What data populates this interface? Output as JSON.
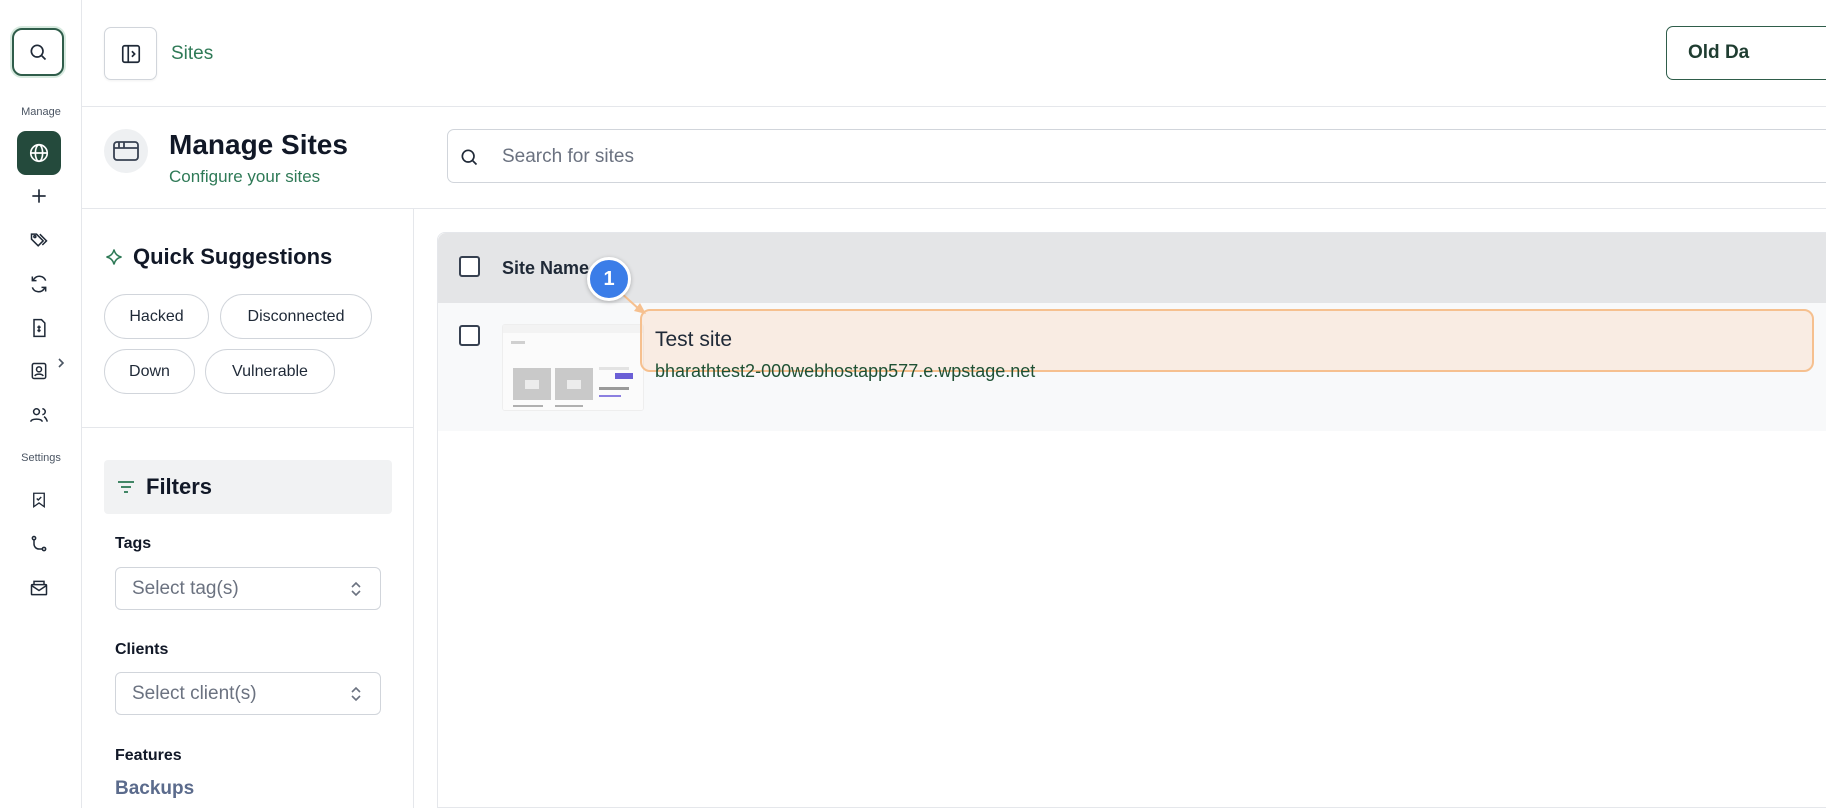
{
  "rail": {
    "manage_label": "Manage",
    "settings_label": "Settings",
    "icons": [
      "search-icon",
      "globe-icon",
      "plus-icon",
      "tags-icon",
      "sync-icon",
      "report-icon",
      "contact-badge-icon",
      "users-icon",
      "bookmark-icon",
      "branch-icon",
      "mail-inbox-icon"
    ]
  },
  "topbar": {
    "breadcrumb": "Sites",
    "old_dashboard_label": "Old Da"
  },
  "page_header": {
    "title": "Manage Sites",
    "subtitle": "Configure your sites"
  },
  "search": {
    "placeholder": "Search for sites"
  },
  "quick_suggestions": {
    "title": "Quick Suggestions",
    "chips": [
      "Hacked",
      "Disconnected",
      "Down",
      "Vulnerable"
    ]
  },
  "filters": {
    "title": "Filters",
    "tags_label": "Tags",
    "tags_placeholder": "Select tag(s)",
    "clients_label": "Clients",
    "clients_placeholder": "Select client(s)",
    "features_label": "Features",
    "features_first": "Backups"
  },
  "table": {
    "column_site_name": "Site Name",
    "rows": [
      {
        "name": "Test site",
        "url": "bharathtest2-000webhostapp577.e.wpstage.net"
      }
    ]
  },
  "annotation": {
    "marker_number": "1"
  },
  "colors": {
    "brand_green": "#244a3c",
    "link_green": "#2f7a57",
    "marker_blue": "#3b7de8",
    "highlight_orange": "#f6c08f"
  }
}
